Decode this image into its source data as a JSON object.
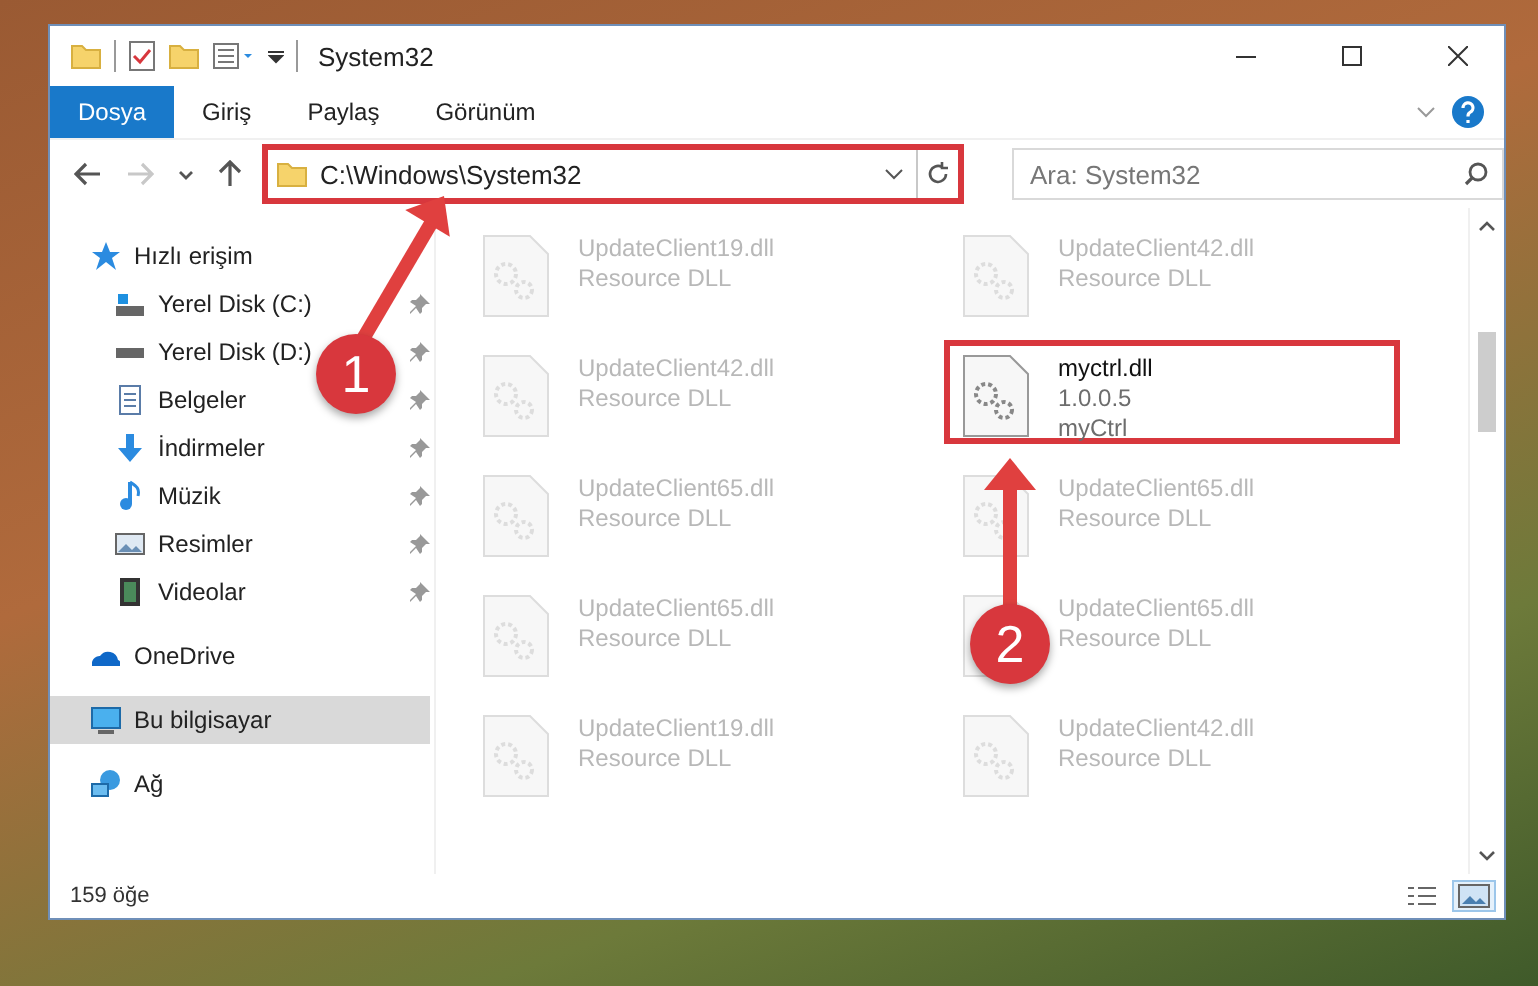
{
  "window": {
    "title": "System32"
  },
  "ribbon_tabs": [
    {
      "label": "Dosya",
      "selected": true
    },
    {
      "label": "Giriş",
      "selected": false
    },
    {
      "label": "Paylaş",
      "selected": false
    },
    {
      "label": "Görünüm",
      "selected": false
    }
  ],
  "address_bar": {
    "path": "C:\\Windows\\System32",
    "highlighted": true
  },
  "search": {
    "placeholder": "Ara: System32"
  },
  "nav_buttons": [
    {
      "kind": "back",
      "disabled": false
    },
    {
      "kind": "forward",
      "disabled": true
    },
    {
      "kind": "recent",
      "disabled": false
    },
    {
      "kind": "up",
      "disabled": false
    }
  ],
  "sidebar": {
    "items": [
      {
        "label": "Hızlı erişim",
        "kind": "star",
        "selected": false,
        "children": [
          {
            "label": "Yerel Disk (C:)",
            "kind": "drive-c",
            "selected": false,
            "pinned": true
          },
          {
            "label": "Yerel Disk (D:)",
            "kind": "drive",
            "selected": false,
            "pinned": true
          },
          {
            "label": "Belgeler",
            "kind": "document",
            "selected": false,
            "pinned": true
          },
          {
            "label": "İndirmeler",
            "kind": "download",
            "selected": false,
            "pinned": true
          },
          {
            "label": "Müzik",
            "kind": "music",
            "selected": false,
            "pinned": true
          },
          {
            "label": "Resimler",
            "kind": "picture",
            "selected": false,
            "pinned": true
          },
          {
            "label": "Videolar",
            "kind": "video",
            "selected": false,
            "pinned": true
          }
        ]
      },
      {
        "label": "OneDrive",
        "kind": "cloud",
        "selected": false
      },
      {
        "label": "Bu bilgisayar",
        "kind": "computer",
        "selected": true
      },
      {
        "label": "Ağ",
        "kind": "network",
        "selected": false
      }
    ]
  },
  "files": [
    {
      "kind": "blurred",
      "lines": [
        "UpdateClient19.dll",
        "Resource DLL"
      ]
    },
    {
      "kind": "blurred",
      "lines": [
        "UpdateClient42.dll",
        "Resource DLL"
      ]
    },
    {
      "kind": "blurred",
      "lines": [
        "UpdateClient42.dll",
        "Resource DLL"
      ]
    },
    {
      "kind": "highlighted",
      "lines": [
        "myctrl.dll",
        "1.0.0.5",
        "myCtrl"
      ]
    },
    {
      "kind": "blurred",
      "lines": [
        "UpdateClient65.dll",
        "Resource DLL"
      ]
    },
    {
      "kind": "blurred",
      "lines": [
        "UpdateClient65.dll",
        "Resource DLL"
      ]
    },
    {
      "kind": "blurred",
      "lines": [
        "UpdateClient65.dll",
        "Resource DLL"
      ]
    },
    {
      "kind": "blurred",
      "lines": [
        "UpdateClient65.dll",
        "Resource DLL"
      ]
    },
    {
      "kind": "blurred",
      "lines": [
        "UpdateClient19.dll",
        "Resource DLL"
      ]
    },
    {
      "kind": "blurred",
      "lines": [
        "UpdateClient42.dll",
        "Resource DLL"
      ]
    }
  ],
  "status_bar": {
    "item_count": "159 öğe",
    "views": [
      {
        "kind": "details",
        "selected": false
      },
      {
        "kind": "large-icons",
        "selected": true
      }
    ]
  },
  "callouts": [
    {
      "number": "1"
    },
    {
      "number": "2"
    }
  ]
}
